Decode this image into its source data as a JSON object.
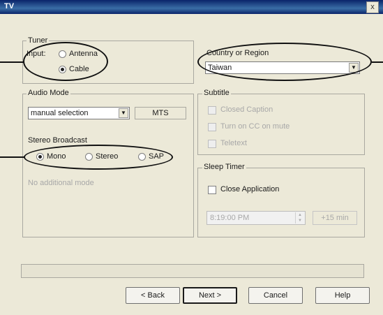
{
  "window": {
    "title": "TV",
    "close_glyph": "x",
    "close_icon": "close-icon"
  },
  "tuner": {
    "group_label": "Tuner",
    "input_label": "Input:",
    "options": [
      {
        "label": "Antenna",
        "selected": false
      },
      {
        "label": "Cable",
        "selected": true
      }
    ]
  },
  "country": {
    "group_label": "Country or Region",
    "value": "Taiwan"
  },
  "audio_mode": {
    "group_label": "Audio Mode",
    "selection": "manual selection",
    "mts_label": "MTS"
  },
  "stereo": {
    "group_label": "Stereo Broadcast",
    "options": [
      {
        "label": "Mono",
        "selected": true
      },
      {
        "label": "Stereo",
        "selected": false
      },
      {
        "label": "SAP",
        "selected": false
      }
    ],
    "disabled_text": "No additional mode"
  },
  "subtitle": {
    "group_label": "Subtitle",
    "items": [
      "Closed Caption",
      "Turn on CC on mute",
      "Teletext"
    ]
  },
  "sleep_timer": {
    "group_label": "Sleep Timer",
    "checkbox_label": "Close Application",
    "time_value": "8:19:00 PM",
    "offset_label": "+15 min"
  },
  "buttons": {
    "back": "< Back",
    "next": "Next >",
    "cancel": "Cancel",
    "help": "Help"
  },
  "colors": {
    "accent_title": "#0a246a",
    "face": "#ece9d8",
    "highlight": "#111111"
  }
}
